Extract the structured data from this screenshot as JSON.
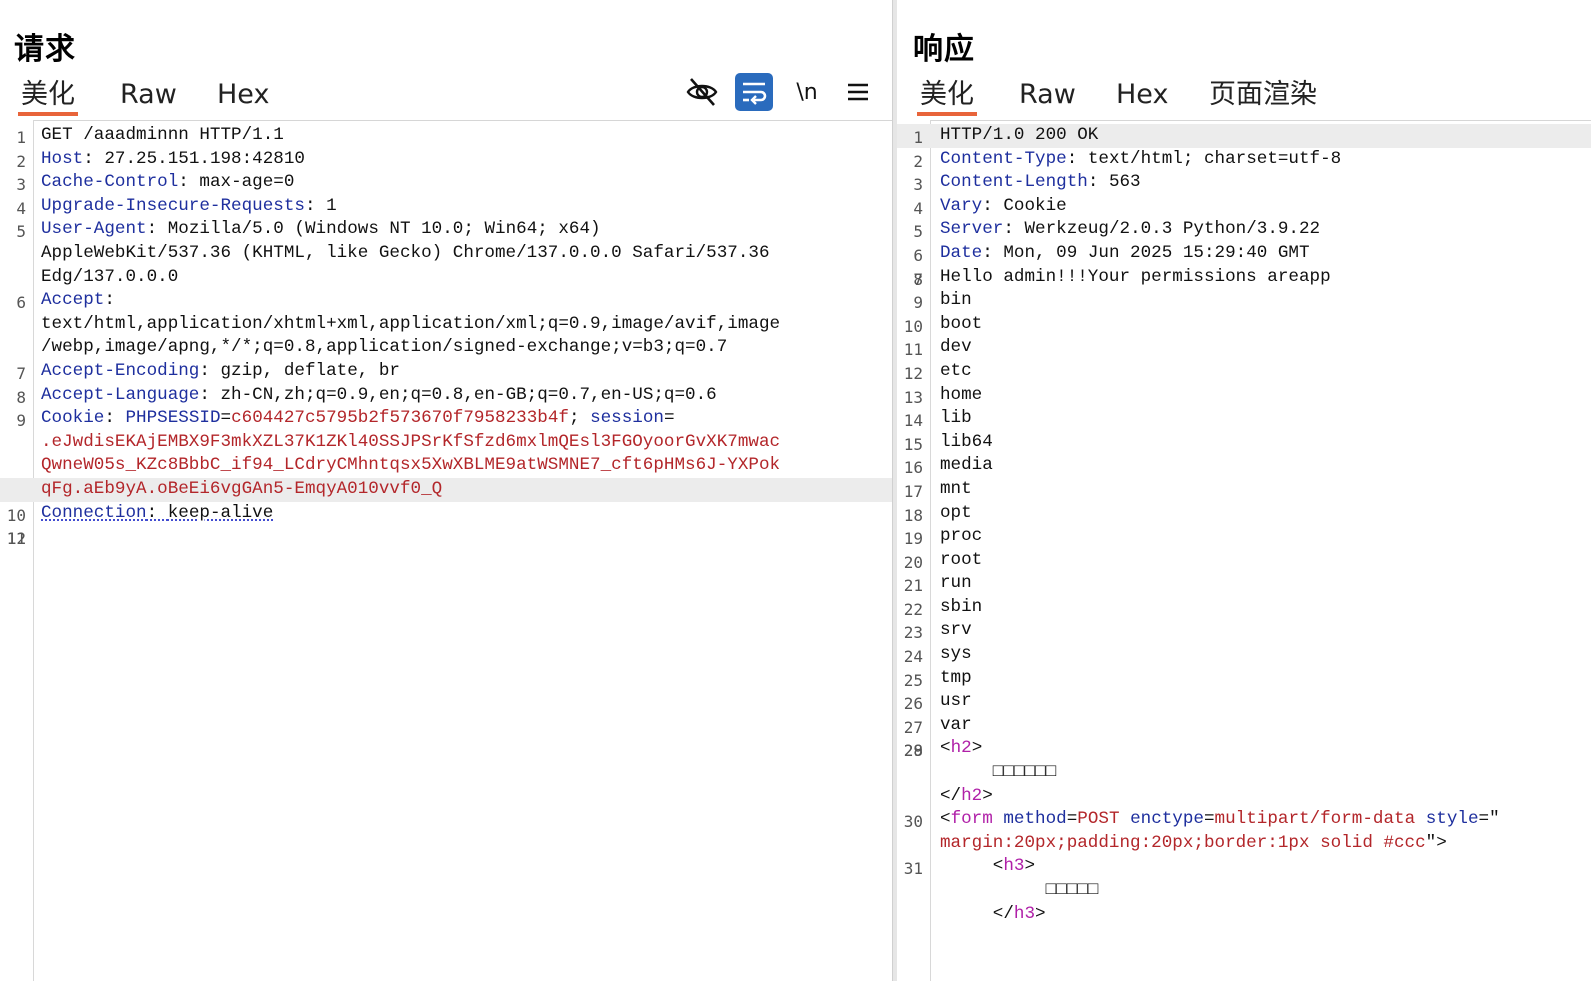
{
  "request": {
    "title": "请求",
    "tabs": [
      "美化",
      "Raw",
      "Hex"
    ],
    "toolbar": {
      "icons": [
        "eye-slash-icon",
        "wrap-lines-icon",
        "newline-icon",
        "menu-icon"
      ],
      "newline_label": "\\n"
    },
    "lines": [
      {
        "n": "1",
        "text": "GET /aaadminnn HTTP/1.1"
      },
      {
        "n": "2",
        "key": "Host",
        "sep": ": ",
        "val": "27.25.151.198:42810"
      },
      {
        "n": "3",
        "key": "Cache-Control",
        "sep": ": ",
        "val": "max-age=0"
      },
      {
        "n": "4",
        "key": "Upgrade-Insecure-Requests",
        "sep": ": ",
        "val": "1"
      },
      {
        "n": "5",
        "key": "User-Agent",
        "sep": ": ",
        "val": "Mozilla/5.0 (Windows NT 10.0; Win64; x64)"
      },
      {
        "n": "",
        "text": "AppleWebKit/537.36 (KHTML, like Gecko) Chrome/137.0.0.0 Safari/537.36"
      },
      {
        "n": "",
        "text": "Edg/137.0.0.0"
      },
      {
        "n": "6",
        "key": "Accept",
        "sep": ":",
        "val": ""
      },
      {
        "n": "",
        "text": "text/html,application/xhtml+xml,application/xml;q=0.9,image/avif,image"
      },
      {
        "n": "",
        "text": "/webp,image/apng,*/*;q=0.8,application/signed-exchange;v=b3;q=0.7"
      },
      {
        "n": "7",
        "key": "Accept-Encoding",
        "sep": ": ",
        "val": "gzip, deflate, br"
      },
      {
        "n": "8",
        "key": "Accept-Language",
        "sep": ": ",
        "val": "zh-CN,zh;q=0.9,en;q=0.8,en-GB;q=0.7,en-US;q=0.6"
      },
      {
        "n": "9",
        "cookie": true,
        "key": "Cookie",
        "sep": ": ",
        "c1k": "PHPSESSID",
        "c1v": "c604427c5795b2f573670f7958233b4f",
        "c2k": "session"
      },
      {
        "n": "",
        "redtext": ".eJwdisEKAjEMBX9F3mkXZL37K1ZKl40SSJPSrKfSfzd6mxlmQEsl3FGOyoorGvXK7mwac"
      },
      {
        "n": "",
        "redtext": "QwneW05s_KZc8BbbC_if94_LCdryCMhntqsx5XwXBLME9atWSMNE7_cft6pHMs6J-YXPok"
      },
      {
        "n": "",
        "redtext": "qFg.aEb9yA.oBeEi6vgGAn5-EmqyA010vvf0_Q",
        "highlight": true
      },
      {
        "n": "10",
        "key": "Connection",
        "sep": ": ",
        "val": "keep-alive",
        "squiggle": true
      },
      {
        "n": "11",
        "text": ""
      },
      {
        "n": "12",
        "text": ""
      }
    ]
  },
  "response": {
    "title": "响应",
    "tabs": [
      "美化",
      "Raw",
      "Hex",
      "页面渲染"
    ],
    "lines": [
      {
        "n": "1",
        "text": "HTTP/1.0 200 OK",
        "highlight": true
      },
      {
        "n": "2",
        "key": "Content-Type",
        "sep": ": ",
        "val": "text/html; charset=utf-8"
      },
      {
        "n": "3",
        "key": "Content-Length",
        "sep": ": ",
        "val": "563"
      },
      {
        "n": "4",
        "key": "Vary",
        "sep": ": ",
        "val": "Cookie"
      },
      {
        "n": "5",
        "key": "Server",
        "sep": ": ",
        "val": "Werkzeug/2.0.3 Python/3.9.22"
      },
      {
        "n": "6",
        "key": "Date",
        "sep": ": ",
        "val": "Mon, 09 Jun 2025 15:29:40 GMT"
      },
      {
        "n": "7",
        "text": ""
      },
      {
        "n": "8",
        "text": "Hello admin!!!Your permissions areapp"
      },
      {
        "n": "9",
        "text": "bin"
      },
      {
        "n": "10",
        "text": "boot"
      },
      {
        "n": "11",
        "text": "dev"
      },
      {
        "n": "12",
        "text": "etc"
      },
      {
        "n": "13",
        "text": "home"
      },
      {
        "n": "14",
        "text": "lib"
      },
      {
        "n": "15",
        "text": "lib64"
      },
      {
        "n": "16",
        "text": "media"
      },
      {
        "n": "17",
        "text": "mnt"
      },
      {
        "n": "18",
        "text": "opt"
      },
      {
        "n": "19",
        "text": "proc"
      },
      {
        "n": "20",
        "text": "root"
      },
      {
        "n": "21",
        "text": "run"
      },
      {
        "n": "22",
        "text": "sbin"
      },
      {
        "n": "23",
        "text": "srv"
      },
      {
        "n": "24",
        "text": "sys"
      },
      {
        "n": "25",
        "text": "tmp"
      },
      {
        "n": "26",
        "text": "usr"
      },
      {
        "n": "27",
        "text": "var"
      },
      {
        "n": "28",
        "text": ""
      },
      {
        "n": "29",
        "tag": "<h2>",
        "tagname": "h2"
      },
      {
        "n": "",
        "text": "     □□□□□□"
      },
      {
        "n": "",
        "tag": "</h2>",
        "tagname": "h2",
        "close": true
      },
      {
        "n": "30",
        "form": true,
        "attr1": "method",
        "val1": "POST",
        "attr2": "enctype",
        "val2": "multipart/form-data",
        "attr3": "style",
        "val3start": "\""
      },
      {
        "n": "",
        "formcont": "margin:20px;padding:20px;border:1px solid #ccc",
        "formend": "\">"
      },
      {
        "n": "31",
        "indent": "     ",
        "tagname": "h3"
      },
      {
        "n": "",
        "text": "          □□□□□"
      },
      {
        "n": "",
        "indent": "     ",
        "tagname": "h3",
        "close": true
      }
    ]
  },
  "colors": {
    "accent": "#e8643a",
    "key": "#1e2f9e",
    "value": "#b3262a",
    "tag": "#b020a8",
    "active_button": "#2a6bbd"
  }
}
